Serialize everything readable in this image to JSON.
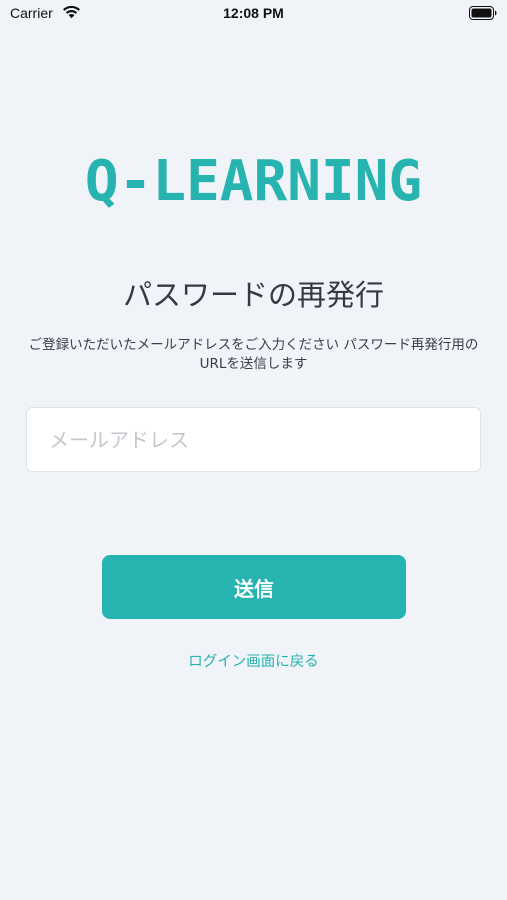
{
  "status_bar": {
    "carrier": "Carrier",
    "time": "12:08 PM",
    "wifi_icon": "wifi-icon",
    "battery_icon": "battery-icon"
  },
  "logo": {
    "text": "Q-LEARNING",
    "color": "#27b3b0"
  },
  "page": {
    "title": "パスワードの再発行",
    "description": "ご登録いただいたメールアドレスをご入力ください パスワード再発行用のURLを送信します"
  },
  "form": {
    "email_value": "",
    "email_placeholder": "メールアドレス",
    "submit_label": "送信",
    "accent_color": "#27b3b0"
  },
  "links": {
    "back_to_login": "ログイン画面に戻る"
  }
}
